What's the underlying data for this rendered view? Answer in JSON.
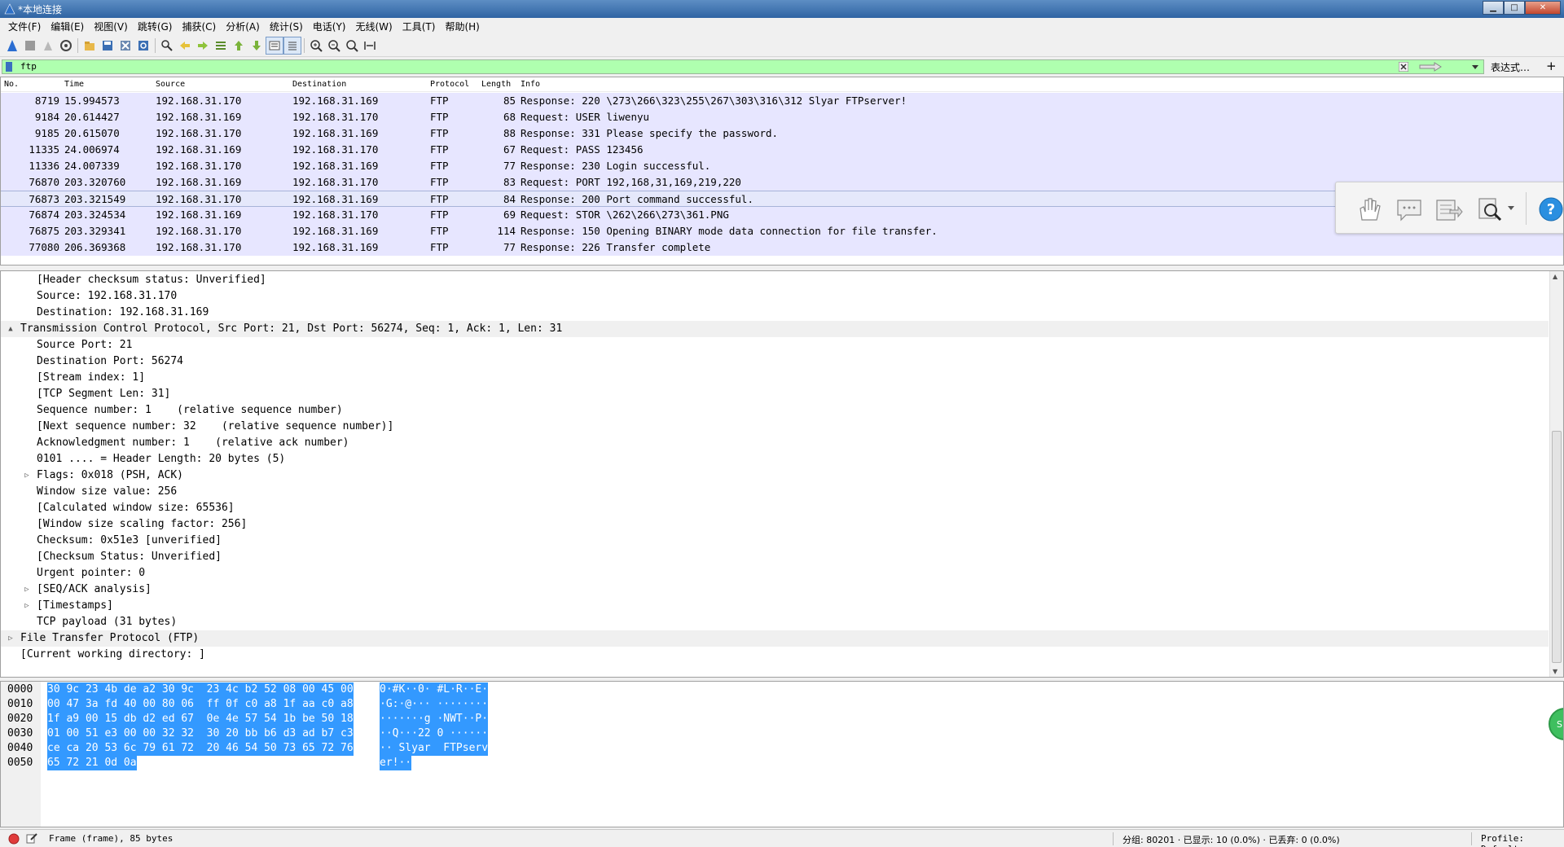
{
  "window": {
    "title": "*本地连接"
  },
  "menu": [
    "文件(F)",
    "编辑(E)",
    "视图(V)",
    "跳转(G)",
    "捕获(C)",
    "分析(A)",
    "统计(S)",
    "电话(Y)",
    "无线(W)",
    "工具(T)",
    "帮助(H)"
  ],
  "filter": {
    "value": "ftp",
    "expression_label": "表达式…",
    "plus_label": "+"
  },
  "packet_list": {
    "columns": [
      "No.",
      "Time",
      "Source",
      "Destination",
      "Protocol",
      "Length",
      "Info"
    ],
    "rows": [
      {
        "no": "8719",
        "time": "15.994573",
        "src": "192.168.31.170",
        "dst": "192.168.31.169",
        "proto": "FTP",
        "len": "85",
        "info": "Response: 220 \\273\\266\\323\\255\\267\\303\\316\\312 Slyar FTPserver!"
      },
      {
        "no": "9184",
        "time": "20.614427",
        "src": "192.168.31.169",
        "dst": "192.168.31.170",
        "proto": "FTP",
        "len": "68",
        "info": "Request: USER liwenyu"
      },
      {
        "no": "9185",
        "time": "20.615070",
        "src": "192.168.31.170",
        "dst": "192.168.31.169",
        "proto": "FTP",
        "len": "88",
        "info": "Response: 331 Please specify the password."
      },
      {
        "no": "11335",
        "time": "24.006974",
        "src": "192.168.31.169",
        "dst": "192.168.31.170",
        "proto": "FTP",
        "len": "67",
        "info": "Request: PASS 123456"
      },
      {
        "no": "11336",
        "time": "24.007339",
        "src": "192.168.31.170",
        "dst": "192.168.31.169",
        "proto": "FTP",
        "len": "77",
        "info": "Response: 230 Login successful."
      },
      {
        "no": "76870",
        "time": "203.320760",
        "src": "192.168.31.169",
        "dst": "192.168.31.170",
        "proto": "FTP",
        "len": "83",
        "info": "Request: PORT 192,168,31,169,219,220"
      },
      {
        "no": "76873",
        "time": "203.321549",
        "src": "192.168.31.170",
        "dst": "192.168.31.169",
        "proto": "FTP",
        "len": "84",
        "info": "Response: 200 Port command successful."
      },
      {
        "no": "76874",
        "time": "203.324534",
        "src": "192.168.31.169",
        "dst": "192.168.31.170",
        "proto": "FTP",
        "len": "69",
        "info": "Request: STOR \\262\\266\\273\\361.PNG"
      },
      {
        "no": "76875",
        "time": "203.329341",
        "src": "192.168.31.170",
        "dst": "192.168.31.169",
        "proto": "FTP",
        "len": "114",
        "info": "Response: 150 Opening BINARY mode data connection for file transfer."
      },
      {
        "no": "77080",
        "time": "206.369368",
        "src": "192.168.31.170",
        "dst": "192.168.31.169",
        "proto": "FTP",
        "len": "77",
        "info": "Response: 226 Transfer complete"
      }
    ]
  },
  "details": [
    {
      "indent": 2,
      "arrow": "",
      "text": "[Header checksum status: Unverified]"
    },
    {
      "indent": 2,
      "arrow": "",
      "text": "Source: 192.168.31.170"
    },
    {
      "indent": 2,
      "arrow": "",
      "text": "Destination: 192.168.31.169"
    },
    {
      "indent": 1,
      "arrow": "▲",
      "text": "Transmission Control Protocol, Src Port: 21, Dst Port: 56274, Seq: 1, Ack: 1, Len: 31",
      "section": true
    },
    {
      "indent": 2,
      "arrow": "",
      "text": "Source Port: 21"
    },
    {
      "indent": 2,
      "arrow": "",
      "text": "Destination Port: 56274"
    },
    {
      "indent": 2,
      "arrow": "",
      "text": "[Stream index: 1]"
    },
    {
      "indent": 2,
      "arrow": "",
      "text": "[TCP Segment Len: 31]"
    },
    {
      "indent": 2,
      "arrow": "",
      "text": "Sequence number: 1    (relative sequence number)"
    },
    {
      "indent": 2,
      "arrow": "",
      "text": "[Next sequence number: 32    (relative sequence number)]"
    },
    {
      "indent": 2,
      "arrow": "",
      "text": "Acknowledgment number: 1    (relative ack number)"
    },
    {
      "indent": 2,
      "arrow": "",
      "text": "0101 .... = Header Length: 20 bytes (5)"
    },
    {
      "indent": 2,
      "arrow": "▷",
      "text": "Flags: 0x018 (PSH, ACK)"
    },
    {
      "indent": 2,
      "arrow": "",
      "text": "Window size value: 256"
    },
    {
      "indent": 2,
      "arrow": "",
      "text": "[Calculated window size: 65536]"
    },
    {
      "indent": 2,
      "arrow": "",
      "text": "[Window size scaling factor: 256]"
    },
    {
      "indent": 2,
      "arrow": "",
      "text": "Checksum: 0x51e3 [unverified]"
    },
    {
      "indent": 2,
      "arrow": "",
      "text": "[Checksum Status: Unverified]"
    },
    {
      "indent": 2,
      "arrow": "",
      "text": "Urgent pointer: 0"
    },
    {
      "indent": 2,
      "arrow": "▷",
      "text": "[SEQ/ACK analysis]"
    },
    {
      "indent": 2,
      "arrow": "▷",
      "text": "[Timestamps]"
    },
    {
      "indent": 2,
      "arrow": "",
      "text": "TCP payload (31 bytes)"
    },
    {
      "indent": 1,
      "arrow": "▷",
      "text": "File Transfer Protocol (FTP)",
      "section": true
    },
    {
      "indent": 1,
      "arrow": "",
      "text": "[Current working directory: ]"
    }
  ],
  "bytes": [
    {
      "off": "0000",
      "hex": "30 9c 23 4b de a2 30 9c  23 4c b2 52 08 00 45 00",
      "asc": "0·#K··0· #L·R··E·"
    },
    {
      "off": "0010",
      "hex": "00 47 3a fd 40 00 80 06  ff 0f c0 a8 1f aa c0 a8",
      "asc": "·G:·@··· ········"
    },
    {
      "off": "0020",
      "hex": "1f a9 00 15 db d2 ed 67  0e 4e 57 54 1b be 50 18",
      "asc": "·······g ·NWT··P·"
    },
    {
      "off": "0030",
      "hex": "01 00 51 e3 00 00 32 32  30 20 bb b6 d3 ad b7 c3",
      "asc": "··Q···22 0 ······"
    },
    {
      "off": "0040",
      "hex": "ce ca 20 53 6c 79 61 72  20 46 54 50 73 65 72 76",
      "asc": "·· Slyar  FTPserv"
    },
    {
      "off": "0050",
      "hex": "65 72 21 0d 0a",
      "asc": "er!··"
    }
  ],
  "side_tab": "Si",
  "status": {
    "frame": "Frame (frame), 85 bytes",
    "counts": "分组: 80201 · 已显示: 10 (0.0%) · 已丢弃: 0 (0.0%)",
    "profile": "Profile: Default"
  }
}
